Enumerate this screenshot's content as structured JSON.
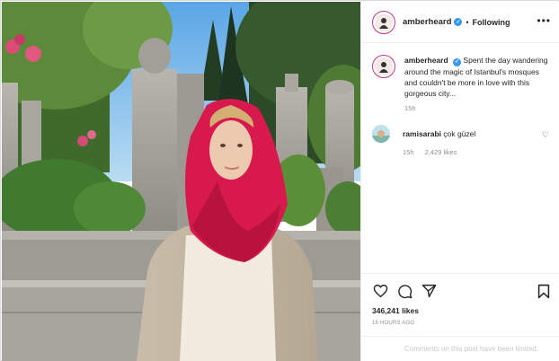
{
  "post": {
    "username": "amberheard",
    "verified_icon": "verified-badge-icon",
    "separator": "•",
    "follow_state": "Following",
    "more_icon": "•••"
  },
  "caption": {
    "username": "amberheard",
    "text": "Spent the day wandering around the magic of Istanbul's mosques and couldn't be more in love with this gorgeous city...",
    "time": "15h"
  },
  "comments": [
    {
      "username": "ramisarabi",
      "text": "çok güzel",
      "time": "15h",
      "likes": "2,429 likes"
    }
  ],
  "actions": {
    "likes": "346,241 likes",
    "post_time": "16 HOURS AGO",
    "icons": [
      "heart-icon",
      "comment-icon",
      "share-icon",
      "bookmark-icon"
    ]
  },
  "footer": {
    "text": "Comments on this post have been limited."
  },
  "colors": {
    "verified": "#3897f0",
    "scarf": "#d8194d",
    "muted_text": "#8e8e8e",
    "border": "#efefef"
  }
}
